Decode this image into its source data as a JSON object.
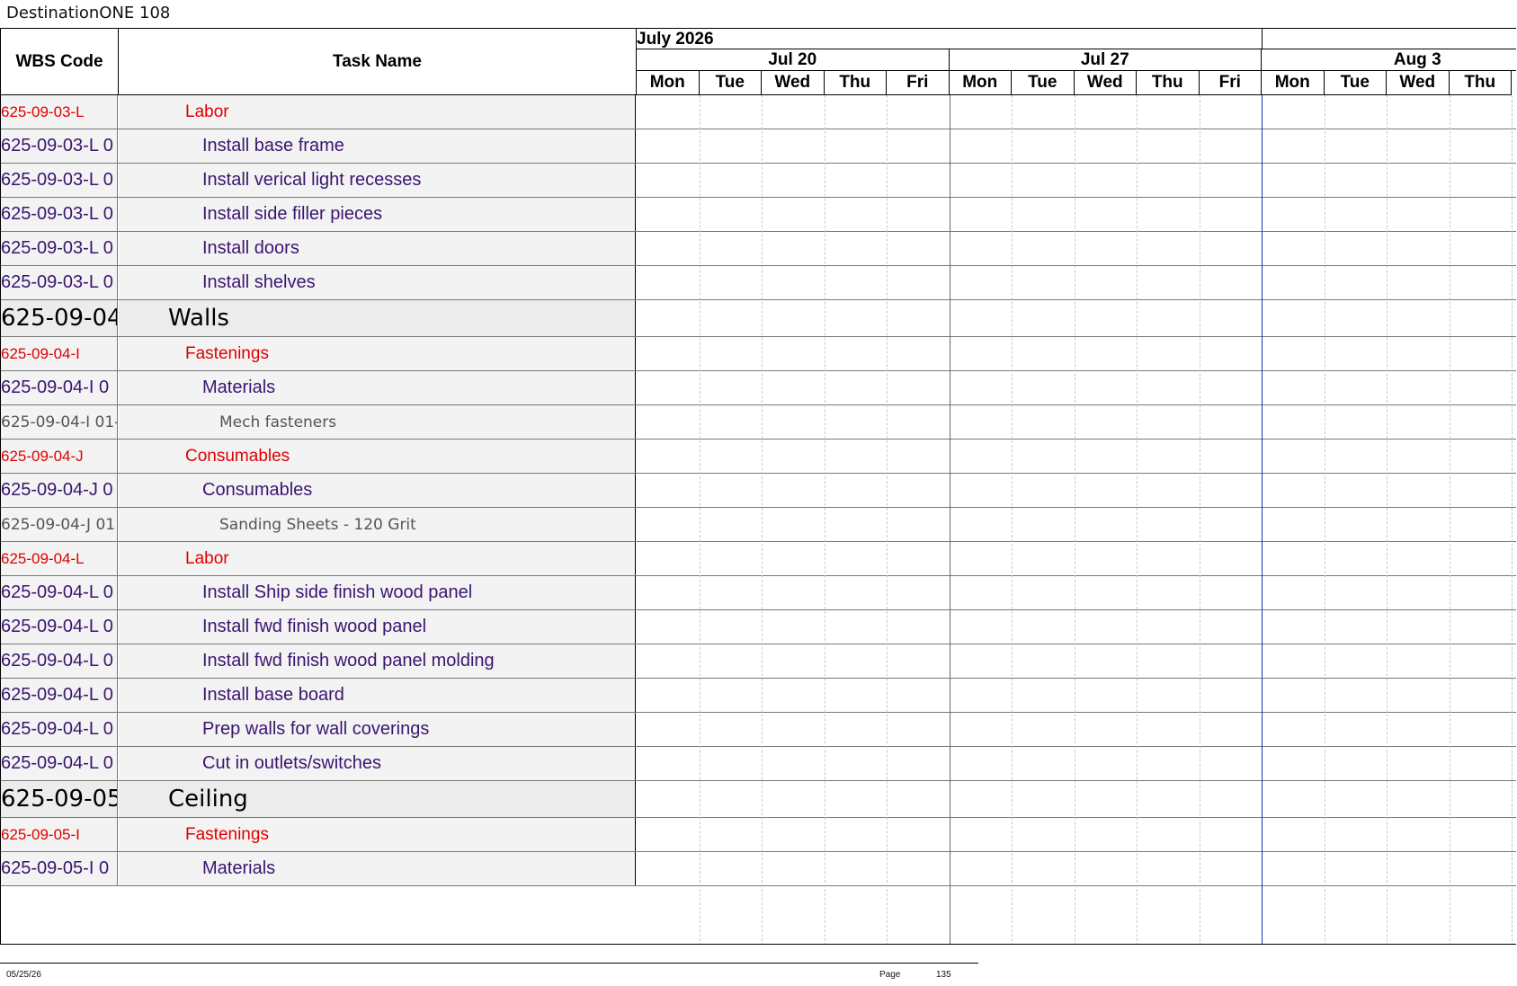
{
  "document": {
    "title": "DestinationONE 108"
  },
  "header": {
    "wbs_label": "WBS Code",
    "task_label": "Task Name"
  },
  "timescale": {
    "months": [
      "July 2026",
      ""
    ],
    "weeks": [
      "Jul 20",
      "Jul 27",
      "Aug 3"
    ],
    "days": [
      "Mon",
      "Tue",
      "Wed",
      "Thu",
      "Fri",
      "Mon",
      "Tue",
      "Wed",
      "Thu",
      "Fri",
      "Mon",
      "Tue",
      "Wed",
      "Thu"
    ]
  },
  "rows": [
    {
      "level": 2,
      "wbs": "625-09-03-L",
      "task": "Labor"
    },
    {
      "level": 3,
      "wbs": "625-09-03-L 0",
      "task": "Install base frame"
    },
    {
      "level": 3,
      "wbs": "625-09-03-L 0",
      "task": "Install verical light recesses"
    },
    {
      "level": 3,
      "wbs": "625-09-03-L 0",
      "task": "Install side filler pieces"
    },
    {
      "level": 3,
      "wbs": "625-09-03-L 0",
      "task": "Install doors"
    },
    {
      "level": 3,
      "wbs": "625-09-03-L 0",
      "task": "Install shelves"
    },
    {
      "level": 1,
      "wbs": "625-09-04",
      "task": "Walls"
    },
    {
      "level": 2,
      "wbs": "625-09-04-I",
      "task": "Fastenings"
    },
    {
      "level": 3,
      "wbs": "625-09-04-I 0",
      "task": "Materials"
    },
    {
      "level": 4,
      "wbs": "625-09-04-I 01-",
      "task": "Mech fasteners"
    },
    {
      "level": 2,
      "wbs": "625-09-04-J",
      "task": "Consumables"
    },
    {
      "level": 3,
      "wbs": "625-09-04-J 0",
      "task": "Consumables"
    },
    {
      "level": 4,
      "wbs": "625-09-04-J 01",
      "task": "Sanding Sheets - 120 Grit"
    },
    {
      "level": 2,
      "wbs": "625-09-04-L",
      "task": "Labor"
    },
    {
      "level": 3,
      "wbs": "625-09-04-L 0",
      "task": "Install Ship side finish wood panel"
    },
    {
      "level": 3,
      "wbs": "625-09-04-L 0",
      "task": "Install fwd finish wood panel"
    },
    {
      "level": 3,
      "wbs": "625-09-04-L 0",
      "task": "Install fwd finish wood panel molding"
    },
    {
      "level": 3,
      "wbs": "625-09-04-L 0",
      "task": "Install base board"
    },
    {
      "level": 3,
      "wbs": "625-09-04-L 0",
      "task": "Prep walls for wall coverings"
    },
    {
      "level": 3,
      "wbs": "625-09-04-L 0",
      "task": "Cut in outlets/switches"
    },
    {
      "level": 1,
      "wbs": "625-09-05",
      "task": "Ceiling"
    },
    {
      "level": 2,
      "wbs": "625-09-05-I",
      "task": "Fastenings"
    },
    {
      "level": 3,
      "wbs": "625-09-05-I 0",
      "task": "Materials"
    }
  ],
  "footer": {
    "date": "05/25/26",
    "page_label": "Page",
    "page_number": "135"
  }
}
